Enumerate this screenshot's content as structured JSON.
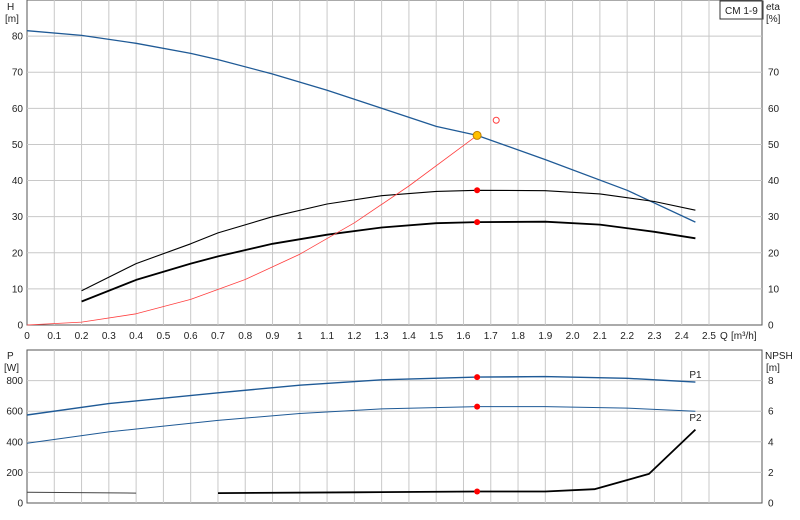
{
  "colors": {
    "head": "#1f5a96",
    "eta": "#000000",
    "system": "#ff4040",
    "op_point": "#ff0000",
    "op_head": "#ffc000",
    "power": "#1f5a96",
    "npsh": "#000000"
  },
  "legend_label": "CM 1-9",
  "chart_data": [
    {
      "type": "line",
      "panel": "top",
      "x_axis": {
        "label": "Q",
        "unit": "[m³/h]",
        "range": [
          0,
          2.5
        ],
        "ticks": [
          "0",
          "0.1",
          "0.2",
          "0.3",
          "0.4",
          "0.5",
          "0.6",
          "0.7",
          "0.8",
          "0.9",
          "1",
          "1.1",
          "1.2",
          "1.3",
          "1.4",
          "1.5",
          "1.6",
          "1.7",
          "1.8",
          "1.9",
          "2.0",
          "2.1",
          "2.2",
          "2.3",
          "2.4",
          "2.5"
        ]
      },
      "y_left": {
        "label": "H",
        "unit": "[m]",
        "range": [
          0,
          90
        ],
        "ticks": [
          "0",
          "10",
          "20",
          "30",
          "40",
          "50",
          "60",
          "70",
          "80"
        ]
      },
      "y_right": {
        "label": "eta",
        "unit": "[%]",
        "range": [
          0,
          90
        ],
        "ticks": [
          "0",
          "10",
          "20",
          "30",
          "40",
          "50",
          "60",
          "70"
        ]
      },
      "grid": true,
      "series": [
        {
          "role": "head",
          "x": [
            0,
            0.2,
            0.4,
            0.6,
            0.7,
            0.9,
            1.1,
            1.3,
            1.5,
            1.65,
            1.9,
            2.2,
            2.45
          ],
          "y": [
            81.5,
            80.2,
            78.0,
            75.2,
            73.5,
            69.5,
            65.0,
            60.0,
            55.0,
            52.5,
            45.8,
            37.3,
            28.5
          ]
        },
        {
          "role": "eta",
          "x": [
            0.2,
            0.4,
            0.6,
            0.7,
            0.9,
            1.1,
            1.3,
            1.5,
            1.65,
            1.9,
            2.1,
            2.3,
            2.45
          ],
          "y": [
            9.5,
            17.0,
            22.5,
            25.5,
            30.0,
            33.5,
            35.8,
            37.0,
            37.3,
            37.2,
            36.3,
            34.2,
            31.8
          ]
        },
        {
          "role": "eta",
          "x": [
            0.2,
            0.4,
            0.6,
            0.7,
            0.9,
            1.1,
            1.3,
            1.5,
            1.65,
            1.9,
            2.1,
            2.3,
            2.45
          ],
          "y": [
            6.5,
            12.5,
            17.0,
            19.0,
            22.5,
            25.0,
            27.0,
            28.2,
            28.5,
            28.6,
            27.8,
            25.8,
            24.0
          ]
        },
        {
          "role": "system",
          "x": [
            0,
            0.2,
            0.4,
            0.6,
            0.8,
            1.0,
            1.2,
            1.4,
            1.65
          ],
          "y": [
            0,
            0.8,
            3.1,
            7.1,
            12.6,
            19.6,
            28.3,
            38.5,
            52.5
          ]
        }
      ],
      "points": [
        {
          "role": "op_head",
          "x": 1.65,
          "y": 52.5
        },
        {
          "role": "op_point",
          "x": 1.65,
          "y": 37.3
        },
        {
          "role": "op_point",
          "x": 1.65,
          "y": 28.5
        },
        {
          "role": "marker_hollow",
          "x": 1.72,
          "y": 56.7
        }
      ]
    },
    {
      "type": "line",
      "panel": "bottom",
      "x_axis": {
        "range": [
          0,
          2.5
        ]
      },
      "y_left": {
        "label": "P",
        "unit": "[W]",
        "range": [
          0,
          1000
        ],
        "ticks": [
          "0",
          "200",
          "400",
          "600",
          "800"
        ]
      },
      "y_right": {
        "label": "NPSH",
        "unit": "[m]",
        "range": [
          0,
          10
        ],
        "ticks": [
          "0",
          "2",
          "4",
          "6",
          "8"
        ]
      },
      "grid": true,
      "series": [
        {
          "role": "power",
          "name": "P1",
          "x": [
            0,
            0.3,
            0.7,
            1.0,
            1.3,
            1.65,
            1.9,
            2.2,
            2.45
          ],
          "y": [
            575,
            650,
            720,
            770,
            805,
            823,
            826,
            815,
            790
          ]
        },
        {
          "role": "power",
          "name": "P2",
          "x": [
            0,
            0.3,
            0.7,
            1.0,
            1.3,
            1.65,
            1.9,
            2.2,
            2.45
          ],
          "y": [
            390,
            465,
            540,
            585,
            615,
            630,
            630,
            620,
            600
          ]
        },
        {
          "role": "npsh",
          "x": [
            0,
            0.4
          ],
          "y": [
            0.7,
            0.65
          ]
        },
        {
          "role": "npsh",
          "x": [
            0.7,
            1.2,
            1.65,
            1.9,
            2.08,
            2.28,
            2.45
          ],
          "y": [
            0.65,
            0.7,
            0.75,
            0.75,
            0.9,
            1.9,
            4.8
          ]
        }
      ],
      "points": [
        {
          "role": "op_point",
          "x": 1.65,
          "y": 823
        },
        {
          "role": "op_point",
          "x": 1.65,
          "y": 630
        },
        {
          "role": "op_point_npsh",
          "x": 1.65,
          "y": 0.75
        }
      ]
    }
  ]
}
